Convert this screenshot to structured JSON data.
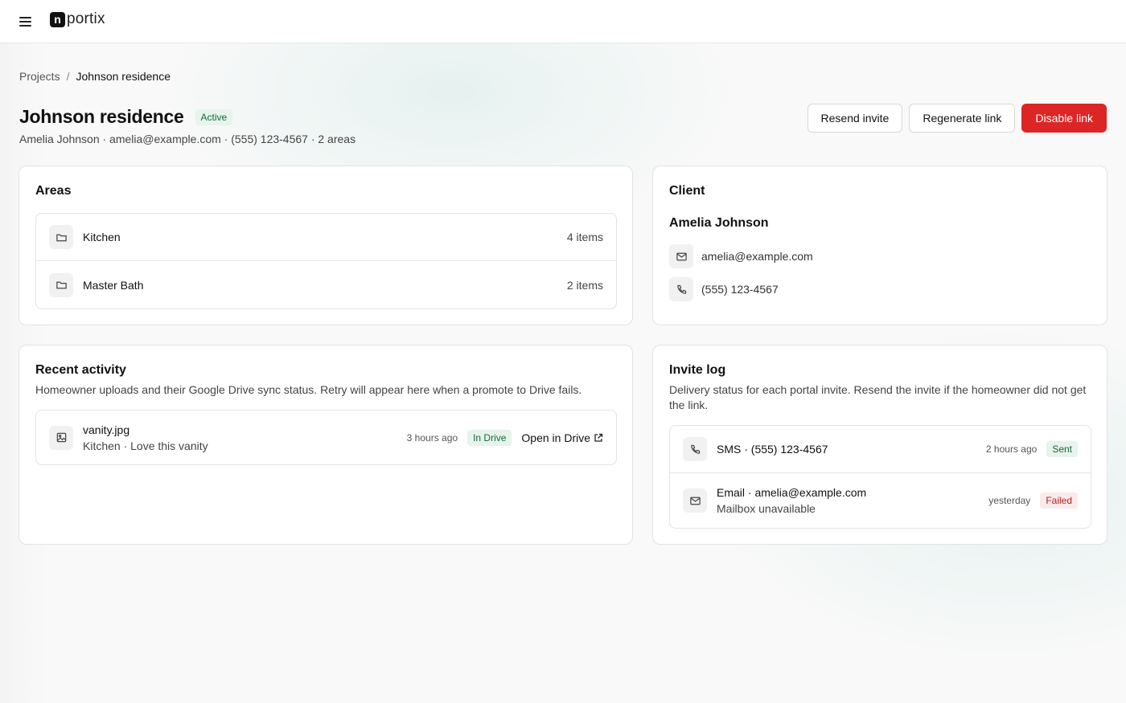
{
  "app": {
    "logo_mark": "n",
    "logo_text": "portix"
  },
  "breadcrumb": {
    "parent": "Projects",
    "separator": "/",
    "current": "Johnson residence"
  },
  "header": {
    "title": "Johnson residence",
    "status": "Active",
    "subtitle": "Amelia Johnson · amelia@example.com · (555) 123-4567 · 2 areas"
  },
  "actions": {
    "resend_label": "Resend invite",
    "regenerate_label": "Regenerate link",
    "disable_label": "Disable link"
  },
  "areas": {
    "title": "Areas",
    "items": [
      {
        "name": "Kitchen",
        "count": "4 items",
        "icon": "folder-icon"
      },
      {
        "name": "Master Bath",
        "count": "2 items",
        "icon": "folder-icon"
      }
    ]
  },
  "client": {
    "title": "Client",
    "name": "Amelia Johnson",
    "email": "amelia@example.com",
    "phone": "(555) 123-4567"
  },
  "activity": {
    "title": "Recent activity",
    "description": "Homeowner uploads and their Google Drive sync status. Retry will appear here when a promote to Drive fails.",
    "items": [
      {
        "file": "vanity.jpg",
        "detail": "Kitchen · Love this vanity",
        "time": "3 hours ago",
        "status": "In Drive",
        "action": "Open in Drive",
        "icon": "image-icon"
      }
    ]
  },
  "invite_log": {
    "title": "Invite log",
    "description": "Delivery status for each portal invite. Resend the invite if the homeowner did not get the link.",
    "items": [
      {
        "channel": "SMS · (555) 123-4567",
        "time": "2 hours ago",
        "status": "Sent",
        "icon": "phone-icon"
      },
      {
        "channel": "Email · amelia@example.com",
        "detail": "Mailbox unavailable",
        "time": "yesterday",
        "status": "Failed",
        "icon": "mail-icon"
      }
    ]
  },
  "colors": {
    "danger": "#dc2626",
    "success_bg": "#e6f4ec",
    "success_text": "#166a3b",
    "failed_bg": "#fbeaea",
    "failed_text": "#b42323"
  }
}
